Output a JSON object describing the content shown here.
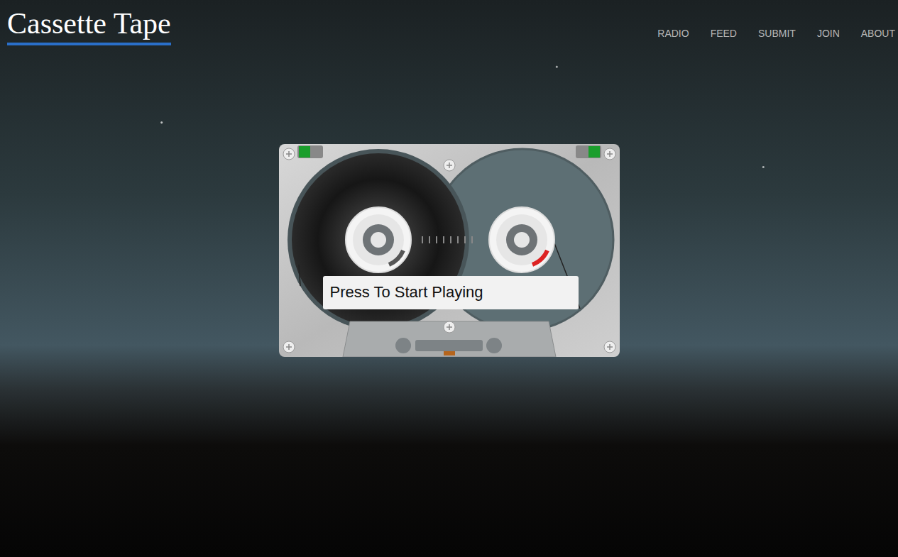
{
  "logo": {
    "text": "Cassette Tape"
  },
  "nav": [
    {
      "label": "RADIO"
    },
    {
      "label": "FEED"
    },
    {
      "label": "SUBMIT"
    },
    {
      "label": "JOIN"
    },
    {
      "label": "ABOUT"
    }
  ],
  "player": {
    "label": "Press To Start Playing"
  }
}
